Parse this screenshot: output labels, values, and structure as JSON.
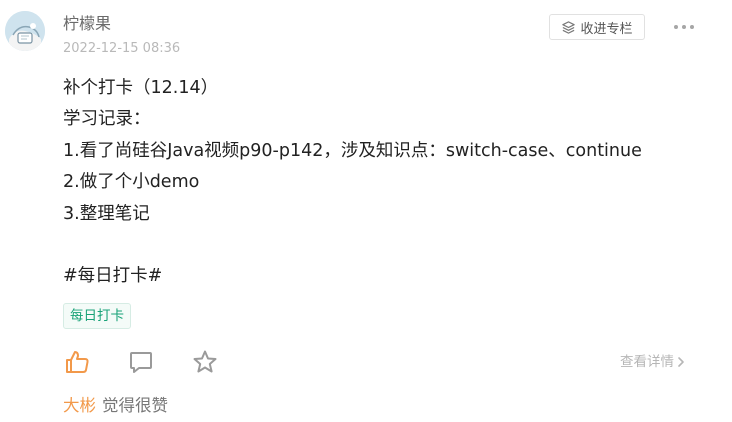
{
  "post": {
    "author": "柠檬果",
    "timestamp": "2022-12-15 08:36",
    "content_lines": [
      "补个打卡（12.14）",
      "学习记录：",
      "1.看了尚硅谷Java视频p90-p142，涉及知识点：switch-case、continue",
      "2.做了个小demo",
      "3.整理笔记",
      "",
      "#每日打卡#"
    ],
    "tag": "每日打卡"
  },
  "header": {
    "collect_label": "收进专栏",
    "more_icon": "more-dots-icon"
  },
  "actions": {
    "like_icon": "thumbs-up-icon",
    "comment_icon": "comment-icon",
    "favorite_icon": "star-icon",
    "details_label": "查看详情"
  },
  "likes": {
    "liker": "大彬",
    "text": "觉得很赞"
  },
  "colors": {
    "accent_orange": "#f2994a",
    "tag_green": "#17a277",
    "icon_gray": "#9a9a9a"
  }
}
